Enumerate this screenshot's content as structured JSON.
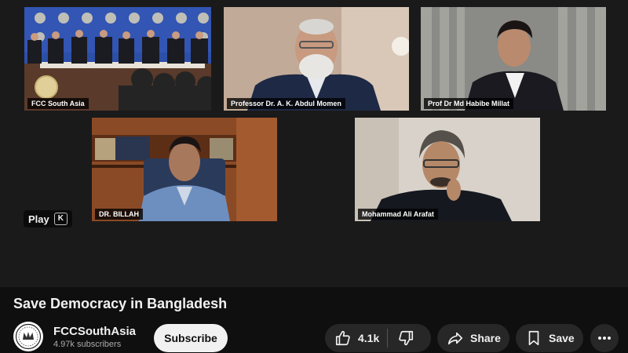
{
  "player": {
    "participants": [
      {
        "name": "FCC South Asia"
      },
      {
        "name": "Professor Dr. A. K. Abdul Momen"
      },
      {
        "name": "Prof Dr Md Habibe Millat"
      },
      {
        "name": "DR. BILLAH"
      },
      {
        "name": "Mohammad Ali Arafat"
      }
    ],
    "play_hint": {
      "label": "Play",
      "key": "K"
    }
  },
  "video": {
    "title": "Save Democracy in Bangladesh"
  },
  "channel": {
    "name": "FCCSouthAsia",
    "subscribers": "4.97k subscribers",
    "subscribe_label": "Subscribe"
  },
  "actions": {
    "like_count": "4.1k",
    "share_label": "Share",
    "save_label": "Save"
  },
  "icons": {
    "like": "thumbs-up-icon",
    "dislike": "thumbs-down-icon",
    "share": "share-icon",
    "save": "bookmark-icon",
    "more": "more-horizontal-icon"
  },
  "colors": {
    "background": "#0f0f0f",
    "pill": "#272727",
    "subscribe_bg": "#f1f1f1",
    "conference_blue": "#2c4fa8"
  }
}
